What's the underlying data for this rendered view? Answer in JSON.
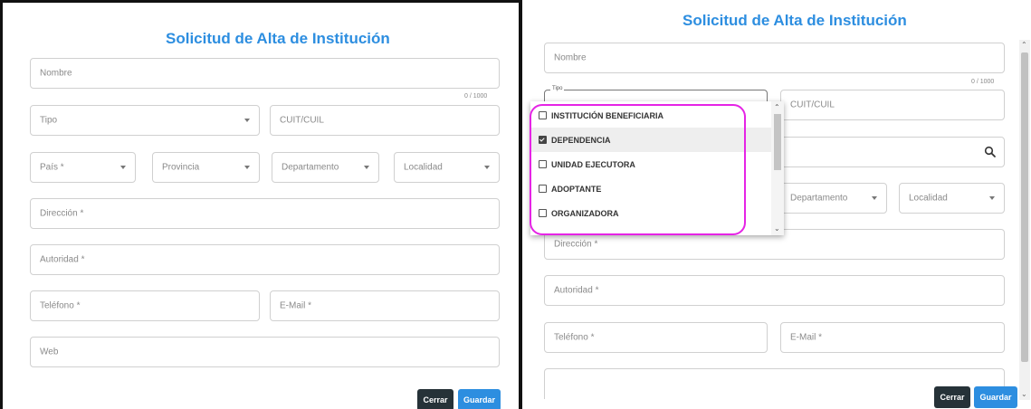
{
  "form": {
    "title": "Solicitud de Alta de Institución",
    "fields": {
      "nombre": "Nombre",
      "counter": "0 / 1000",
      "tipo": "Tipo",
      "cuit": "CUIT/CUIL",
      "pais": "País *",
      "provincia": "Provincia",
      "departamento": "Departamento",
      "localidad": "Localidad",
      "direccion": "Dirección *",
      "autoridad": "Autoridad *",
      "telefono": "Teléfono *",
      "email": "E-Mail *",
      "web": "Web"
    },
    "buttons": {
      "cerrar": "Cerrar",
      "guardar": "Guardar"
    }
  },
  "tipo_dropdown": {
    "label": "Tipo",
    "options": [
      {
        "label": "INSTITUCIÓN BENEFICIARIA",
        "checked": false
      },
      {
        "label": "DEPENDENCIA",
        "checked": true
      },
      {
        "label": "UNIDAD EJECUTORA",
        "checked": false
      },
      {
        "label": "ADOPTANTE",
        "checked": false
      },
      {
        "label": "ORGANIZADORA",
        "checked": false
      }
    ]
  },
  "colors": {
    "accent": "#2d8ee0",
    "dark_button": "#263238",
    "highlight": "#e524e5"
  }
}
